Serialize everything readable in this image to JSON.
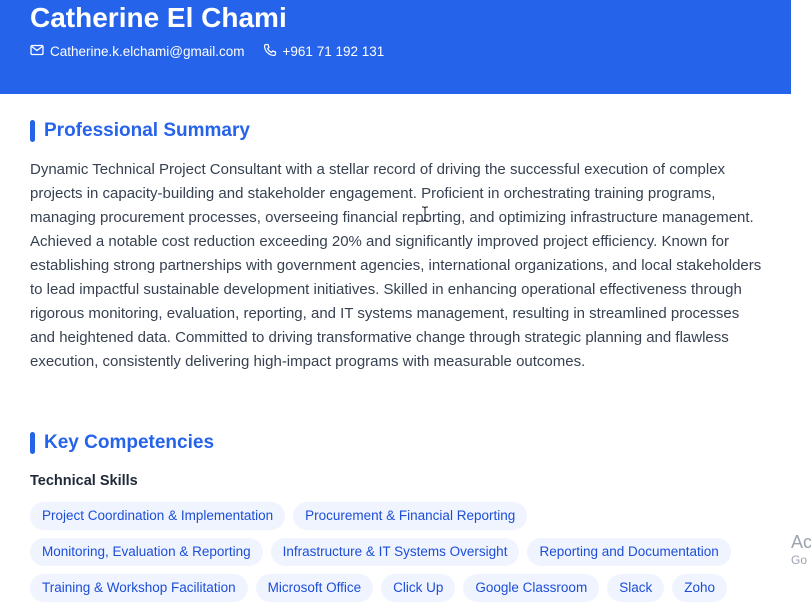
{
  "resume": {
    "name": "Catherine El Chami",
    "email": "Catherine.k.elchami@gmail.com",
    "phone": "+961 71 192 131",
    "email_icon": "mail-icon",
    "phone_icon": "phone-icon"
  },
  "summary": {
    "title": "Professional Summary",
    "text": "Dynamic Technical Project Consultant with a stellar record of driving the successful execution of complex projects in capacity-building and stakeholder engagement. Proficient in orchestrating training programs, managing procurement processes, overseeing financial reporting, and optimizing infrastructure management. Achieved a notable cost reduction exceeding 20% and significantly improved project efficiency. Known for establishing strong partnerships with government agencies, international organizations, and local stakeholders to lead impactful sustainable development initiatives. Skilled in enhancing operational effectiveness through rigorous monitoring, evaluation, reporting, and IT systems management, resulting in streamlined processes and heightened data. Committed to driving transformative change through strategic planning and flawless execution, consistently delivering high-impact programs with measurable outcomes."
  },
  "competencies": {
    "title": "Key Competencies",
    "technical_label": "Technical Skills",
    "rows": [
      [
        "Project Coordination & Implementation",
        "Procurement & Financial Reporting"
      ],
      [
        "Monitoring, Evaluation & Reporting",
        "Infrastructure & IT Systems Oversight",
        "Reporting and Documentation"
      ],
      [
        "Training & Workshop Facilitation",
        "Microsoft Office",
        "Click Up",
        "Google Classroom",
        "Slack",
        "Zoho"
      ]
    ]
  },
  "watermark": {
    "line1": "Ac",
    "line2": "Go"
  },
  "colors": {
    "accent": "#2563eb",
    "chip_bg": "#eff4ff",
    "chip_text": "#1d4ed8"
  }
}
